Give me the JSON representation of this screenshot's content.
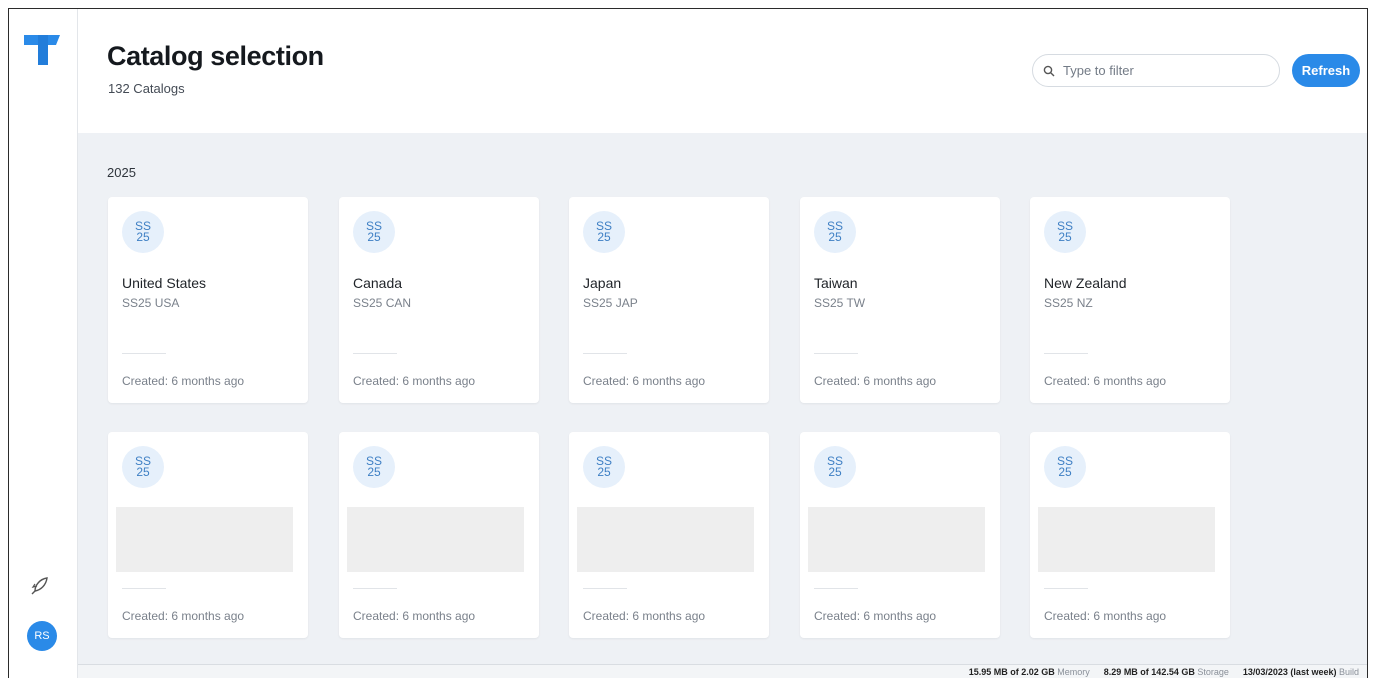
{
  "header": {
    "title": "Catalog selection",
    "subtitle": "132 Catalogs",
    "filter_placeholder": "Type to filter",
    "refresh_label": "Refresh"
  },
  "sidebar": {
    "logo_icon": "brand-logo-icon",
    "rocket_icon": "rocket-icon",
    "avatar_initials": "RS",
    "accent": "#2a8ae8"
  },
  "section": {
    "label": "2025"
  },
  "badge": {
    "line1": "SS",
    "line2": "25"
  },
  "cards_row1": [
    {
      "name": "United States",
      "code": "SS25 USA",
      "created": "Created: 6 months ago"
    },
    {
      "name": "Canada",
      "code": "SS25 CAN",
      "created": "Created: 6 months ago"
    },
    {
      "name": "Japan",
      "code": "SS25 JAP",
      "created": "Created: 6 months ago"
    },
    {
      "name": "Taiwan",
      "code": "SS25 TW",
      "created": "Created: 6 months ago"
    },
    {
      "name": "New Zealand",
      "code": "SS25 NZ",
      "created": "Created: 6 months ago"
    }
  ],
  "cards_row2": [
    {
      "created": "Created: 6 months ago"
    },
    {
      "created": "Created: 6 months ago"
    },
    {
      "created": "Created: 6 months ago"
    },
    {
      "created": "Created: 6 months ago"
    },
    {
      "created": "Created: 6 months ago"
    }
  ],
  "status": {
    "memory_value": "15.95 MB of 2.02 GB",
    "memory_label": "Memory",
    "storage_value": "8.29 MB of 142.54 GB",
    "storage_label": "Storage",
    "build_value": "13/03/2023 (last week)",
    "build_label": "Build"
  }
}
